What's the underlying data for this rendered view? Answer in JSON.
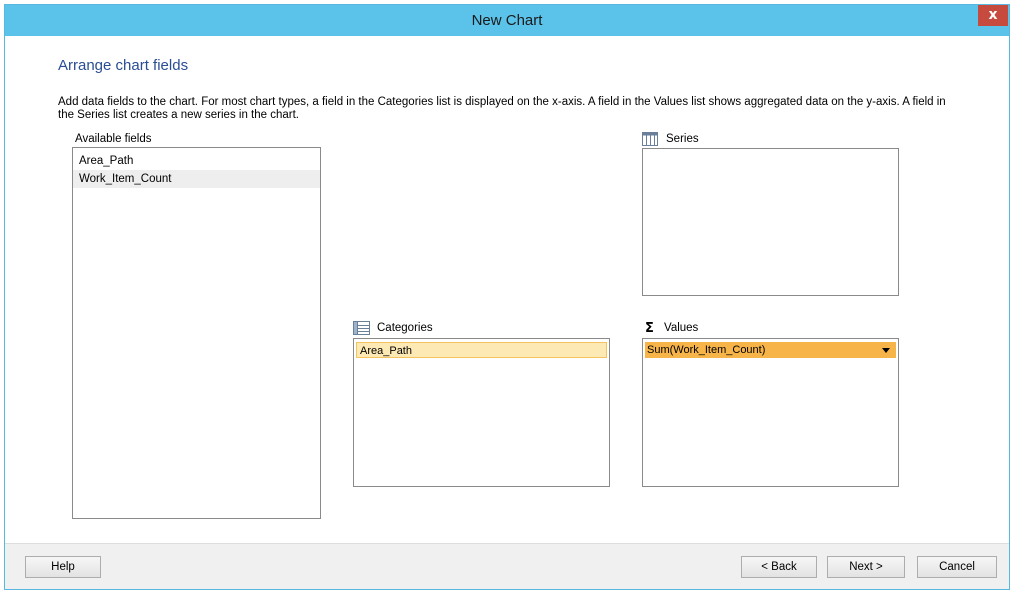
{
  "window": {
    "title": "New Chart",
    "close_label": "x"
  },
  "page": {
    "heading": "Arrange chart fields",
    "description": "Add data fields to the chart. For most chart types, a field in the Categories list is displayed on the x-axis. A field in the Values list shows aggregated data on the y-axis. A field in the Series list creates a new series in the chart."
  },
  "available_fields": {
    "label": "Available fields",
    "items": [
      "Area_Path",
      "Work_Item_Count"
    ]
  },
  "series": {
    "label": "Series",
    "items": [],
    "icon": "table-icon"
  },
  "categories": {
    "label": "Categories",
    "items": [
      "Area_Path"
    ],
    "icon": "list-icon"
  },
  "values": {
    "label": "Values",
    "items": [
      "Sum(Work_Item_Count)"
    ],
    "icon": "sigma-icon",
    "icon_glyph": "Σ"
  },
  "footer": {
    "help_label": "Help",
    "back_label": "< Back",
    "next_label": "Next >",
    "cancel_label": "Cancel"
  },
  "colors": {
    "titlebar": "#5bc2ea",
    "heading": "#2a4d93",
    "category_chip": "#fde9b4",
    "value_chip": "#f7b448",
    "close": "#c74a3f"
  }
}
